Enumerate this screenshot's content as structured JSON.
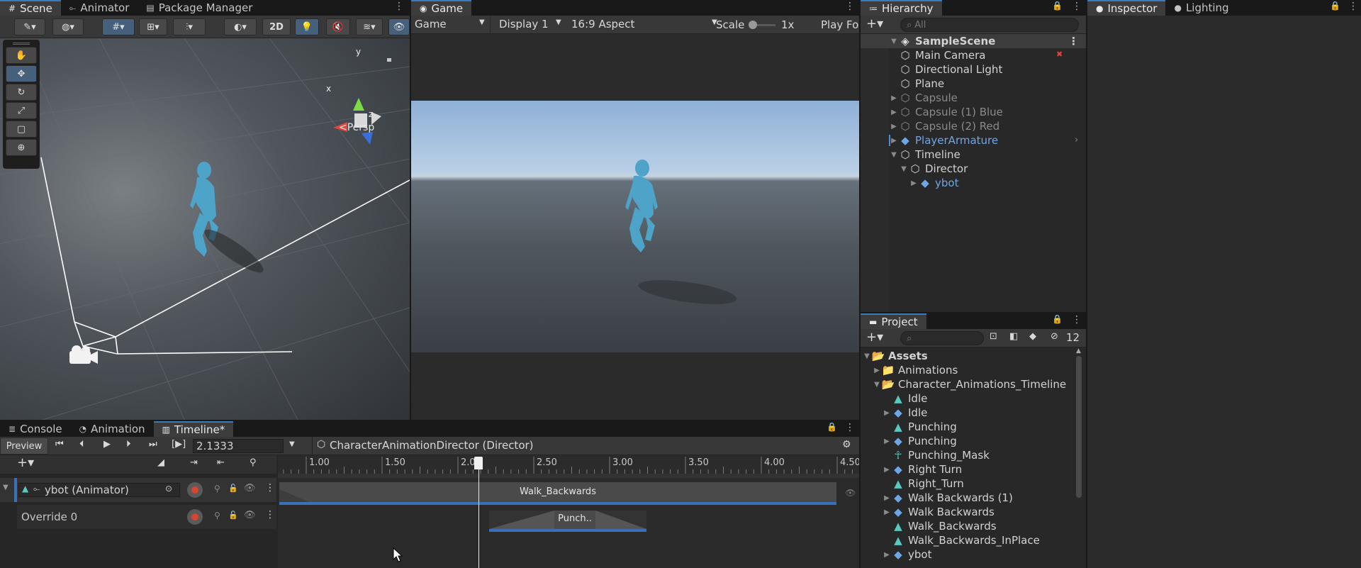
{
  "scene_panel": {
    "tabs": [
      {
        "label": "Scene",
        "icon": "hash-icon"
      },
      {
        "label": "Animator",
        "icon": "animator-icon"
      },
      {
        "label": "Package Manager",
        "icon": "package-icon"
      }
    ],
    "btn_2d": "2D",
    "gizmo": {
      "x": "x",
      "y": "y",
      "z": "z",
      "persp": "<Persp"
    }
  },
  "game_panel": {
    "tab": "Game",
    "mode": "Game",
    "display": "Display 1",
    "aspect": "16:9 Aspect",
    "scale_label": "Scale",
    "scale_value": "1x",
    "play_focused": "Play Fo"
  },
  "hierarchy": {
    "tab": "Hierarchy",
    "search_placeholder": "All",
    "items": [
      {
        "label": "SampleScene",
        "style": "scene"
      },
      {
        "label": "Main Camera",
        "style": "normal"
      },
      {
        "label": "Directional Light",
        "style": "normal"
      },
      {
        "label": "Plane",
        "style": "normal"
      },
      {
        "label": "Capsule",
        "style": "dim"
      },
      {
        "label": "Capsule (1) Blue",
        "style": "dim"
      },
      {
        "label": "Capsule (2) Red",
        "style": "dim"
      },
      {
        "label": "PlayerArmature",
        "style": "blue"
      },
      {
        "label": "Timeline",
        "style": "normal"
      },
      {
        "label": "Director",
        "style": "normal"
      },
      {
        "label": "ybot",
        "style": "blue"
      }
    ]
  },
  "inspector": {
    "tab": "Inspector",
    "lighting_tab": "Lighting"
  },
  "project": {
    "tab": "Project",
    "hidden_count": "12",
    "items": [
      {
        "label": "Assets"
      },
      {
        "label": "Animations"
      },
      {
        "label": "Character_Animations_Timeline"
      },
      {
        "label": "Idle"
      },
      {
        "label": "Idle"
      },
      {
        "label": "Punching"
      },
      {
        "label": "Punching"
      },
      {
        "label": "Punching_Mask"
      },
      {
        "label": "Right Turn"
      },
      {
        "label": "Right_Turn"
      },
      {
        "label": "Walk Backwards (1)"
      },
      {
        "label": "Walk Backwards"
      },
      {
        "label": "Walk_Backwards"
      },
      {
        "label": "Walk_Backwards_InPlace"
      },
      {
        "label": "ybot"
      }
    ]
  },
  "bottom_tabs": [
    {
      "label": "Console",
      "icon": "console-icon"
    },
    {
      "label": "Animation",
      "icon": "animation-icon"
    },
    {
      "label": "Timeline*",
      "icon": "timeline-icon"
    }
  ],
  "timeline": {
    "preview_label": "Preview",
    "frame_bracket": "[▶]",
    "time_value": "2.1333",
    "director_name": "CharacterAnimationDirector (Director)",
    "playhead_time": 2.1333,
    "ruler_labels": [
      "1.00",
      "1.50",
      "2.00",
      "2.50",
      "3.00",
      "3.50",
      "4.00",
      "4.50"
    ],
    "tracks": [
      {
        "label": "ybot (Animator)"
      },
      {
        "label": "Override 0"
      }
    ],
    "clips": [
      {
        "label": "Walk_Backwards"
      },
      {
        "label": "Punch.."
      }
    ]
  }
}
